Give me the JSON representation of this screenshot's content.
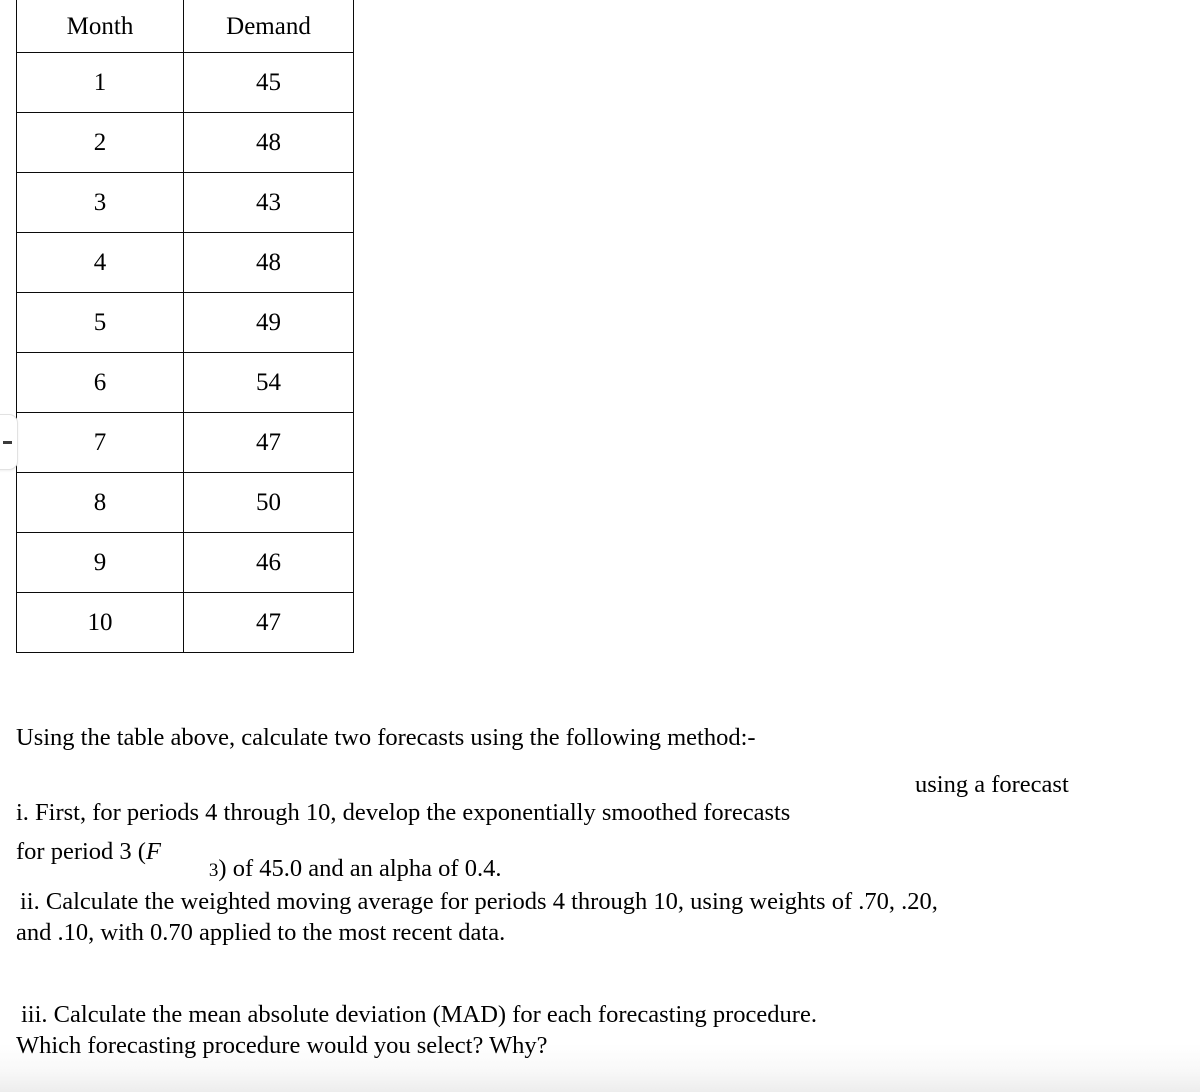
{
  "table": {
    "headers": [
      "Month",
      "Demand"
    ],
    "rows": [
      [
        "1",
        "45"
      ],
      [
        "2",
        "48"
      ],
      [
        "3",
        "43"
      ],
      [
        "4",
        "48"
      ],
      [
        "5",
        "49"
      ],
      [
        "6",
        "54"
      ],
      [
        "7",
        "47"
      ],
      [
        "8",
        "50"
      ],
      [
        "9",
        "46"
      ],
      [
        "10",
        "47"
      ]
    ]
  },
  "prose": {
    "intro": "Using the table above, calculate two forecasts using the following method:-",
    "item_i": {
      "line1": "i. First, for periods 4 through 10, develop the exponentially smoothed forecasts",
      "raised": "using a forecast",
      "line2_pre": "for period 3 (",
      "symbol": "F",
      "subscript": "3",
      "line2_post": ") of 45.0 and an alpha of 0.4."
    },
    "item_ii": {
      "line1": "ii. Calculate the weighted moving average for periods 4 through 10, using weights of  .70, .20,",
      "line2": "and .10, with 0.70 applied to the most recent data."
    },
    "item_iii": {
      "line1": "iii. Calculate the mean absolute deviation (MAD) for each forecasting procedure.",
      "line2": "Which forecasting procedure would you select? Why?"
    }
  },
  "edge_control": {
    "glyph": "minus-icon"
  }
}
